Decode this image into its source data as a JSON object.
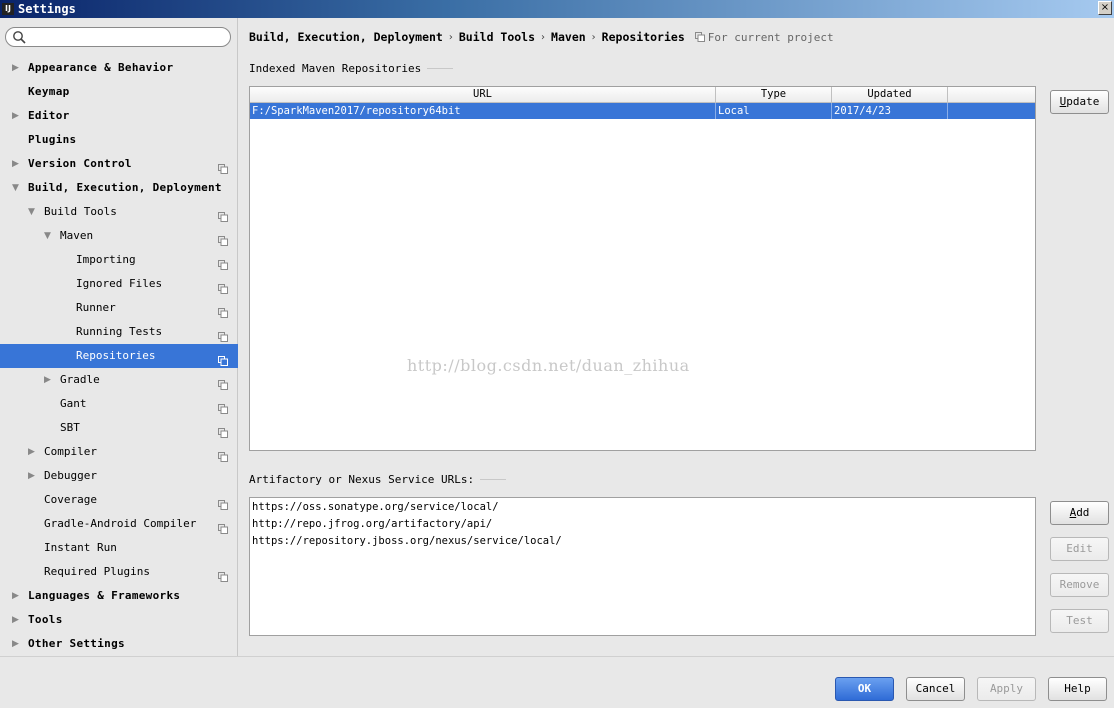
{
  "window": {
    "app_icon": "IJ",
    "title": "Settings",
    "close": "×"
  },
  "search": {
    "placeholder": "",
    "icon": "search-icon"
  },
  "tree": [
    {
      "label": "Appearance & Behavior",
      "level": 0,
      "arrow": "right",
      "bold": true,
      "project": false
    },
    {
      "label": "Keymap",
      "level": 0,
      "arrow": "none",
      "bold": true,
      "project": false
    },
    {
      "label": "Editor",
      "level": 0,
      "arrow": "right",
      "bold": true,
      "project": false
    },
    {
      "label": "Plugins",
      "level": 0,
      "arrow": "none",
      "bold": true,
      "project": false
    },
    {
      "label": "Version Control",
      "level": 0,
      "arrow": "right",
      "bold": true,
      "project": true
    },
    {
      "label": "Build, Execution, Deployment",
      "level": 0,
      "arrow": "down",
      "bold": true,
      "project": false
    },
    {
      "label": "Build Tools",
      "level": 1,
      "arrow": "down",
      "bold": false,
      "project": true
    },
    {
      "label": "Maven",
      "level": 2,
      "arrow": "down",
      "bold": false,
      "project": true
    },
    {
      "label": "Importing",
      "level": 3,
      "arrow": "none",
      "bold": false,
      "project": true
    },
    {
      "label": "Ignored Files",
      "level": 3,
      "arrow": "none",
      "bold": false,
      "project": true
    },
    {
      "label": "Runner",
      "level": 3,
      "arrow": "none",
      "bold": false,
      "project": true
    },
    {
      "label": "Running Tests",
      "level": 3,
      "arrow": "none",
      "bold": false,
      "project": true
    },
    {
      "label": "Repositories",
      "level": 3,
      "arrow": "none",
      "bold": false,
      "project": true,
      "selected": true
    },
    {
      "label": "Gradle",
      "level": 2,
      "arrow": "right",
      "bold": false,
      "project": true
    },
    {
      "label": "Gant",
      "level": 2,
      "arrow": "none",
      "bold": false,
      "project": true
    },
    {
      "label": "SBT",
      "level": 2,
      "arrow": "none",
      "bold": false,
      "project": true
    },
    {
      "label": "Compiler",
      "level": 1,
      "arrow": "right",
      "bold": false,
      "project": true
    },
    {
      "label": "Debugger",
      "level": 1,
      "arrow": "right",
      "bold": false,
      "project": false
    },
    {
      "label": "Coverage",
      "level": 1,
      "arrow": "none",
      "bold": false,
      "project": true
    },
    {
      "label": "Gradle-Android Compiler",
      "level": 1,
      "arrow": "none",
      "bold": false,
      "project": true
    },
    {
      "label": "Instant Run",
      "level": 1,
      "arrow": "none",
      "bold": false,
      "project": false
    },
    {
      "label": "Required Plugins",
      "level": 1,
      "arrow": "none",
      "bold": false,
      "project": true
    },
    {
      "label": "Languages & Frameworks",
      "level": 0,
      "arrow": "right",
      "bold": true,
      "project": false
    },
    {
      "label": "Tools",
      "level": 0,
      "arrow": "right",
      "bold": true,
      "project": false
    },
    {
      "label": "Other Settings",
      "level": 0,
      "arrow": "right",
      "bold": true,
      "project": false
    }
  ],
  "breadcrumb": {
    "items": [
      "Build, Execution, Deployment",
      "Build Tools",
      "Maven",
      "Repositories"
    ],
    "separator": "›",
    "scope": "For current project"
  },
  "indexed": {
    "caption": "Indexed Maven Repositories",
    "columns": [
      "URL",
      "Type",
      "Updated",
      ""
    ],
    "rows": [
      {
        "url": "F:/SparkMaven2017/repository64bit",
        "type": "Local",
        "updated": "2017/4/23",
        "extra": ""
      }
    ],
    "update_button": {
      "mnemonic": "U",
      "rest": "pdate"
    }
  },
  "watermark": "http://blog.csdn.net/duan_zhihua",
  "services": {
    "caption": "Artifactory or Nexus Service URLs:",
    "urls": [
      "https://oss.sonatype.org/service/local/",
      "http://repo.jfrog.org/artifactory/api/",
      "https://repository.jboss.org/nexus/service/local/"
    ],
    "buttons": {
      "add": {
        "mnemonic": "A",
        "rest": "dd"
      },
      "edit": "Edit",
      "remove": "Remove",
      "test": "Test"
    }
  },
  "footer": {
    "ok": "OK",
    "cancel": "Cancel",
    "apply": "Apply",
    "help": "Help"
  },
  "colors": {
    "selection": "#3875d7",
    "panel": "#e8e8e8",
    "primary_button": "#2f6bd6"
  }
}
